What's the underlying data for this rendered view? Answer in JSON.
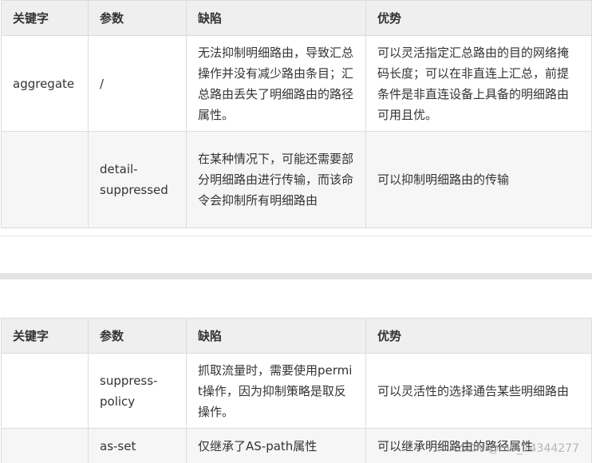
{
  "tables": [
    {
      "headers": [
        "关键字",
        "参数",
        "缺陷",
        "优势"
      ],
      "rows": [
        [
          "aggregate",
          "/",
          "无法抑制明细路由，导致汇总操作并没有减少路由条目；汇总路由丢失了明细路由的路径属性。",
          "可以灵活指定汇总路由的目的网络掩码长度；可以在非直连上汇总，前提条件是非直连设备上具备的明细路由可用且优。"
        ],
        [
          "",
          "detail-suppressed",
          "在某种情况下，可能还需要部分明细路由进行传输，而该命令会抑制所有明细路由",
          "可以抑制明细路由的传输"
        ]
      ]
    },
    {
      "headers": [
        "关键字",
        "参数",
        "缺陷",
        "优势"
      ],
      "rows": [
        [
          "",
          "suppress-policy",
          "抓取流量时，需要使用permit操作，因为抑制策略是取反操作。",
          "可以灵活性的选择通告某些明细路由"
        ],
        [
          "",
          "as-set",
          "仅继承了AS-path属性",
          "可以继承明细路由的路径属性"
        ]
      ]
    }
  ],
  "watermark": "CSDN @m0_74344277"
}
